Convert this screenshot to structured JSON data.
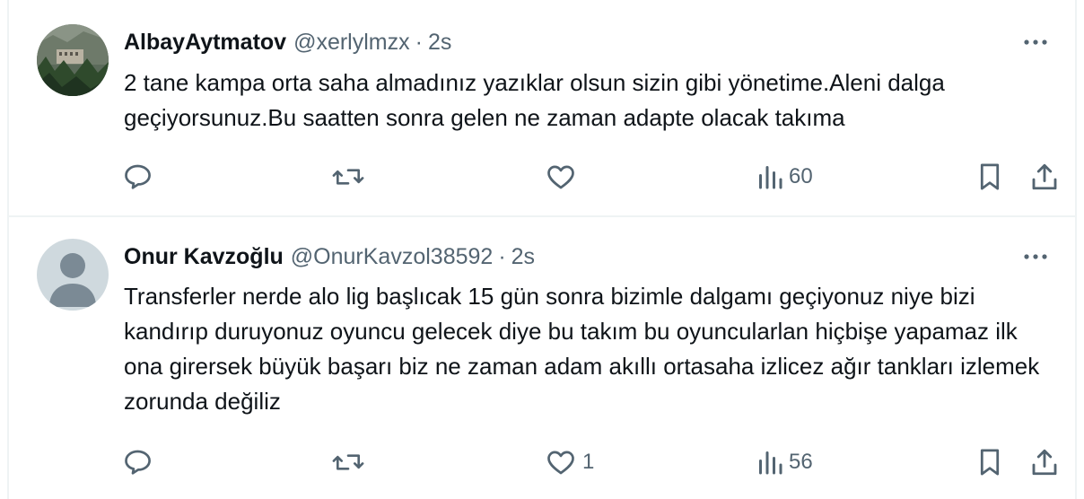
{
  "tweets": [
    {
      "name": "AlbayAytmatov",
      "handle": "@xerlylmzx",
      "separator": "·",
      "time": "2s",
      "text": "2 tane kampa orta saha almadınız yazıklar olsun sizin gibi yönetime.Aleni dalga geçiyorsunuz.Bu saatten sonra gelen ne zaman adapte olacak takıma",
      "replies": "",
      "retweets": "",
      "likes": "",
      "views": "60",
      "avatar": "landscape-photo"
    },
    {
      "name": "Onur Kavzoğlu",
      "handle": "@OnurKavzol38592",
      "separator": "·",
      "time": "2s",
      "text": "Transferler nerde alo lig başlıcak 15 gün sonra bizimle dalgamı geçiyonuz niye bizi kandırıp duruyonuz oyuncu gelecek diye bu takım bu oyuncularlan hiçbişe yapamaz ilk ona girersek büyük başarı biz ne zaman adam akıllı ortasaha izlicez ağır tankları izlemek zorunda değiliz",
      "replies": "",
      "retweets": "",
      "likes": "1",
      "views": "56",
      "avatar": "default-profile"
    }
  ],
  "colors": {
    "text_primary": "#0f1419",
    "text_secondary": "#536471",
    "divider": "#eff3f4",
    "default_avatar_bg": "#cfd9de",
    "default_avatar_fg": "#7b8a95"
  },
  "icons": [
    "reply-icon",
    "retweet-icon",
    "like-icon",
    "views-icon",
    "bookmark-icon",
    "share-icon",
    "more-icon"
  ]
}
